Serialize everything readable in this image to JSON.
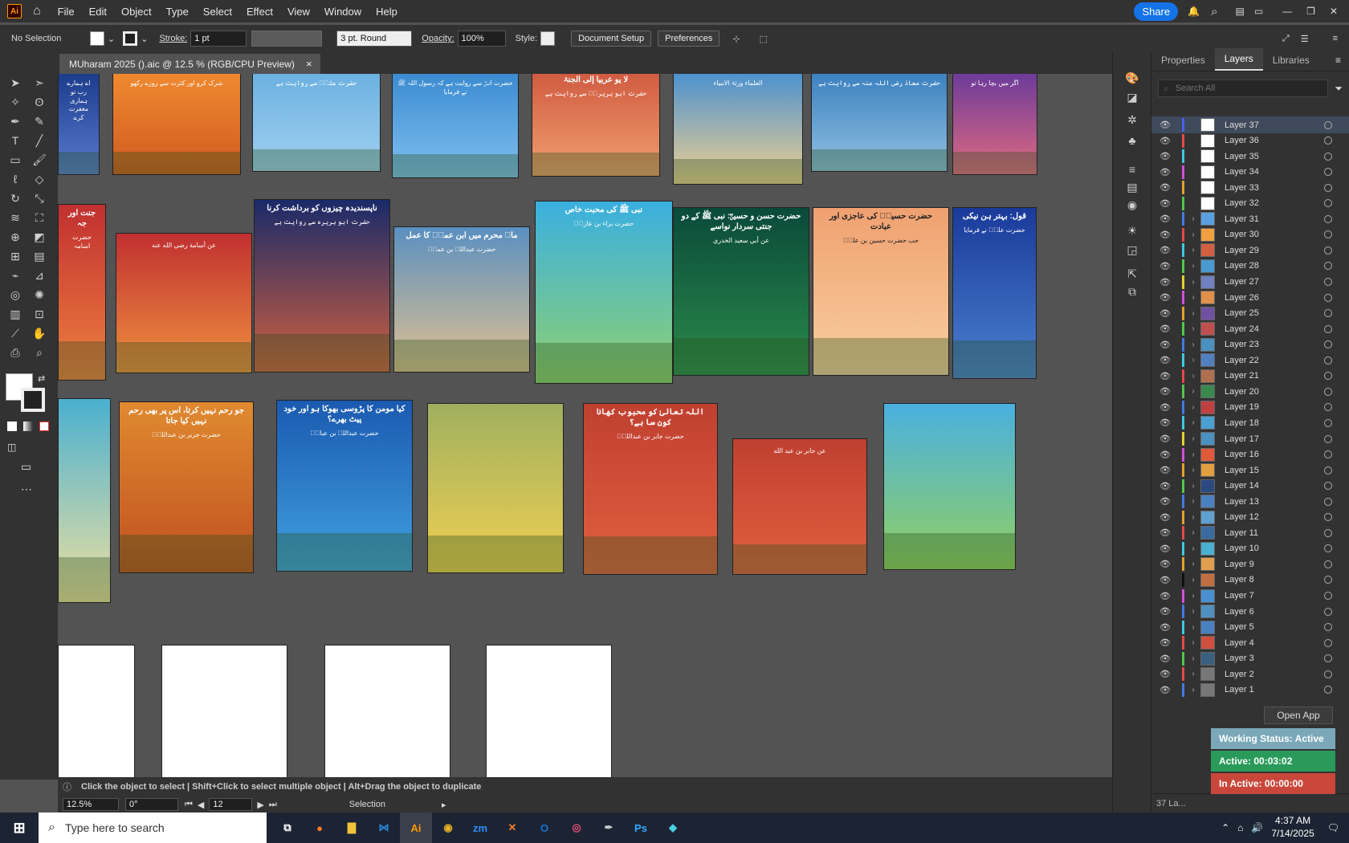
{
  "menubar": {
    "app_icon": "Ai",
    "items": [
      "File",
      "Edit",
      "Object",
      "Type",
      "Select",
      "Effect",
      "View",
      "Window",
      "Help"
    ],
    "share": "Share"
  },
  "control": {
    "selection": "No Selection",
    "stroke_label": "Stroke:",
    "stroke_value": "1 pt",
    "brush": "3 pt. Round",
    "opacity_label": "Opacity:",
    "opacity_value": "100%",
    "style_label": "Style:",
    "doc_setup": "Document Setup",
    "preferences": "Preferences"
  },
  "document": {
    "tab_title": "MUharam 2025 ().aic @ 12.5 % (RGB/CPU Preview)",
    "close": "×"
  },
  "status": {
    "hint": "Click the object to select  |  Shift+Click to select multiple object  |  Alt+Drag the object to duplicate",
    "zoom": "12.5%",
    "rotate": "0°",
    "artboard": "12",
    "tool": "Selection"
  },
  "panel": {
    "tabs": [
      "Properties",
      "Layers",
      "Libraries"
    ],
    "search_placeholder": "Search All",
    "footer_count": "37 La..."
  },
  "layers": [
    {
      "name": "Layer 37",
      "color": "#4a5ef0",
      "thumb": "#ffffff",
      "sub": false
    },
    {
      "name": "Layer 36",
      "color": "#e34a4a",
      "thumb": "#ffffff",
      "sub": false
    },
    {
      "name": "Layer 35",
      "color": "#3fc9e0",
      "thumb": "#ffffff",
      "sub": false
    },
    {
      "name": "Layer 34",
      "color": "#d24fd8",
      "thumb": "#ffffff",
      "sub": false
    },
    {
      "name": "Layer 33",
      "color": "#e3a030",
      "thumb": "#ffffff",
      "sub": false
    },
    {
      "name": "Layer 32",
      "color": "#52c84a",
      "thumb": "#ffffff",
      "sub": false
    },
    {
      "name": "Layer 31",
      "color": "#3f7ae0",
      "thumb": "#5aa0e0",
      "sub": true
    },
    {
      "name": "Layer 30",
      "color": "#e34a4a",
      "thumb": "#f0a040",
      "sub": true
    },
    {
      "name": "Layer 29",
      "color": "#3fc9e0",
      "thumb": "#d06040",
      "sub": true
    },
    {
      "name": "Layer 28",
      "color": "#52c84a",
      "thumb": "#4a9ad0",
      "sub": true
    },
    {
      "name": "Layer 27",
      "color": "#e3d030",
      "thumb": "#7080c0",
      "sub": true
    },
    {
      "name": "Layer 26",
      "color": "#d24fd8",
      "thumb": "#e0904a",
      "sub": true
    },
    {
      "name": "Layer 25",
      "color": "#e3a030",
      "thumb": "#7050a0",
      "sub": true
    },
    {
      "name": "Layer 24",
      "color": "#52c84a",
      "thumb": "#c05050",
      "sub": true
    },
    {
      "name": "Layer 23",
      "color": "#3f7ae0",
      "thumb": "#4a90c0",
      "sub": true
    },
    {
      "name": "Layer 22",
      "color": "#3fc9e0",
      "thumb": "#5080c0",
      "sub": true
    },
    {
      "name": "Layer 21",
      "color": "#e34a4a",
      "thumb": "#b07050",
      "sub": true
    },
    {
      "name": "Layer 20",
      "color": "#52c84a",
      "thumb": "#3a8a50",
      "sub": true
    },
    {
      "name": "Layer 19",
      "color": "#3f7ae0",
      "thumb": "#c04040",
      "sub": true
    },
    {
      "name": "Layer 18",
      "color": "#3fc9e0",
      "thumb": "#4aa0d0",
      "sub": true
    },
    {
      "name": "Layer 17",
      "color": "#e3d030",
      "thumb": "#4a90c0",
      "sub": true
    },
    {
      "name": "Layer 16",
      "color": "#d24fd8",
      "thumb": "#e05a3a",
      "sub": true
    },
    {
      "name": "Layer 15",
      "color": "#e3a030",
      "thumb": "#e0a040",
      "sub": true
    },
    {
      "name": "Layer 14",
      "color": "#52c84a",
      "thumb": "#2a4a80",
      "sub": true
    },
    {
      "name": "Layer 13",
      "color": "#3f7ae0",
      "thumb": "#4a80c0",
      "sub": true
    },
    {
      "name": "Layer 12",
      "color": "#e3a030",
      "thumb": "#60a0d0",
      "sub": true
    },
    {
      "name": "Layer 11",
      "color": "#e34a4a",
      "thumb": "#3a6aa0",
      "sub": true
    },
    {
      "name": "Layer 10",
      "color": "#3fc9e0",
      "thumb": "#4ab0d0",
      "sub": true
    },
    {
      "name": "Layer 9",
      "color": "#e3a030",
      "thumb": "#e0a050",
      "sub": true
    },
    {
      "name": "Layer 8",
      "color": "#111111",
      "thumb": "#c07040",
      "sub": true
    },
    {
      "name": "Layer 7",
      "color": "#d24fd8",
      "thumb": "#4a90d0",
      "sub": true
    },
    {
      "name": "Layer 6",
      "color": "#3f7ae0",
      "thumb": "#5090c0",
      "sub": true
    },
    {
      "name": "Layer 5",
      "color": "#3fc9e0",
      "thumb": "#4a80c0",
      "sub": true
    },
    {
      "name": "Layer 4",
      "color": "#e34a4a",
      "thumb": "#d05040",
      "sub": true
    },
    {
      "name": "Layer 3",
      "color": "#52c84a",
      "thumb": "#3a6080",
      "sub": true
    },
    {
      "name": "Layer 2",
      "color": "#e34a4a",
      "thumb": "#777777",
      "sub": true
    },
    {
      "name": "Layer 1",
      "color": "#3f7ae0",
      "thumb": "#777777",
      "sub": true
    }
  ],
  "tracker": {
    "open_app": "Open App",
    "working": "Working Status: Active",
    "active": "Active: 00:03:02",
    "inactive": "In Active: 00:00:00"
  },
  "taskbar": {
    "search_placeholder": "Type here to search",
    "time": "4:37 AM",
    "date": "7/14/2025"
  },
  "posters": [
    {
      "title": "",
      "body": "اے ہمارے رب تو ہماری مغفرت کرے",
      "bg": "linear-gradient(#1a3a8a,#5a7ad0)"
    },
    {
      "title": "",
      "body": "شرک کرو اور کثرت سے روزے رکھو",
      "bg": "linear-gradient(#f08a30,#d05a20)"
    },
    {
      "title": "",
      "body": "حضرت علیؓ سے روایت ہے",
      "bg": "linear-gradient(#6ab0e0,#a0d0f0)"
    },
    {
      "title": "",
      "body": "حضرت انسؓ سے روایت ہے کہ رسول اللہ ﷺ نے فرمایا",
      "bg": "linear-gradient(#3a8ad0,#80c0f0)"
    },
    {
      "title": "لا یو عربیا إلی الجنۃ",
      "body": "حضرت ابو ہریرہؓ سے روایت ہے",
      "bg": "linear-gradient(#d05a40,#f0a070)"
    },
    {
      "title": "",
      "body": "العلماء ورثۃ الانبیاء",
      "bg": "linear-gradient(#4a90d0,#f0d090)"
    },
    {
      "title": "",
      "body": "حضرت معاذ رضی اللہ عنہ سے روایت ہے",
      "bg": "linear-gradient(#3a80c0,#90c0e0)"
    },
    {
      "title": "",
      "body": "اگر میں بچا رہا تو",
      "bg": "linear-gradient(#6a3a9a,#e06a80)"
    },
    {
      "title": "جنت اور جہ",
      "body": "حضرت اسامہ",
      "bg": "linear-gradient(#c03030,#f08040)"
    },
    {
      "title": "",
      "body": "عن أسامة رضي الله عنه",
      "bg": "linear-gradient(#c03030,#f09040)"
    },
    {
      "title": "ناپسندیدہ چیزوں کو برداشت کرنا",
      "body": "حضرت ابو ہریرہ سے روایت ہے",
      "bg": "linear-gradient(#1a2a6a,#d06040)"
    },
    {
      "title": "ماہ محرم میں ابن عمرؓ کا عمل",
      "body": "حضرت عبداللہ بن عمرؓ",
      "bg": "linear-gradient(#5a90c0,#e0c090)"
    },
    {
      "title": "نبی ﷺ کی محبت خاص",
      "body": "حضرت براء بن عازبؓ",
      "bg": "linear-gradient(#3ab0e0,#90d070)"
    },
    {
      "title": "حضرت حسن و حسینؓ: نبی ﷺ کے دو جنتی سردار نواسے",
      "body": "عن أبي سعيد الخدري",
      "bg": "linear-gradient(#0a4a3a,#2a8a4a)"
    },
    {
      "title": "حضرت حسینؓ کی عاجزی اور عبادت",
      "body": "جب حضرت حسین بن علیؓ",
      "bg": "linear-gradient(#f0a070,#f8d0a0)"
    },
    {
      "title": "قول: بہتر ہن نیکی",
      "body": "حضرت علیؓ نے فرمایا",
      "bg": "linear-gradient(#1a3a9a,#4a80d0)"
    },
    {
      "title": "",
      "body": "",
      "bg": "linear-gradient(#4ab0d0,#f0e0a0)"
    },
    {
      "title": "جو رحم نہیں کرتا، اس پر بھی رحم نہیں کیا جاتا",
      "body": "حضرت جریر بن عبداللہؓ",
      "bg": "linear-gradient(#e08a30,#c05020)"
    },
    {
      "title": "کیا مومن کا پڑوسی بھوکا ہو اور خود پیٹ بھرے؟",
      "body": "حضرت عبداللہ بن عباسؓ",
      "bg": "linear-gradient(#1a5ab0,#40a0e0)"
    },
    {
      "title": "",
      "body": "",
      "bg": "linear-gradient(#a0b060,#f0d050)"
    },
    {
      "title": "اللہ تعالیٰ کو محبوب کھانا کون سا ہے؟",
      "body": "حضرت جابر بن عبداللہؓ",
      "bg": "linear-gradient(#c04030,#e06040)"
    },
    {
      "title": "",
      "body": "عن جابر بن عبد الله",
      "bg": "linear-gradient(#c04030,#e06040)"
    },
    {
      "title": "",
      "body": "",
      "bg": "linear-gradient(#4ab0e0,#90d060)"
    }
  ]
}
